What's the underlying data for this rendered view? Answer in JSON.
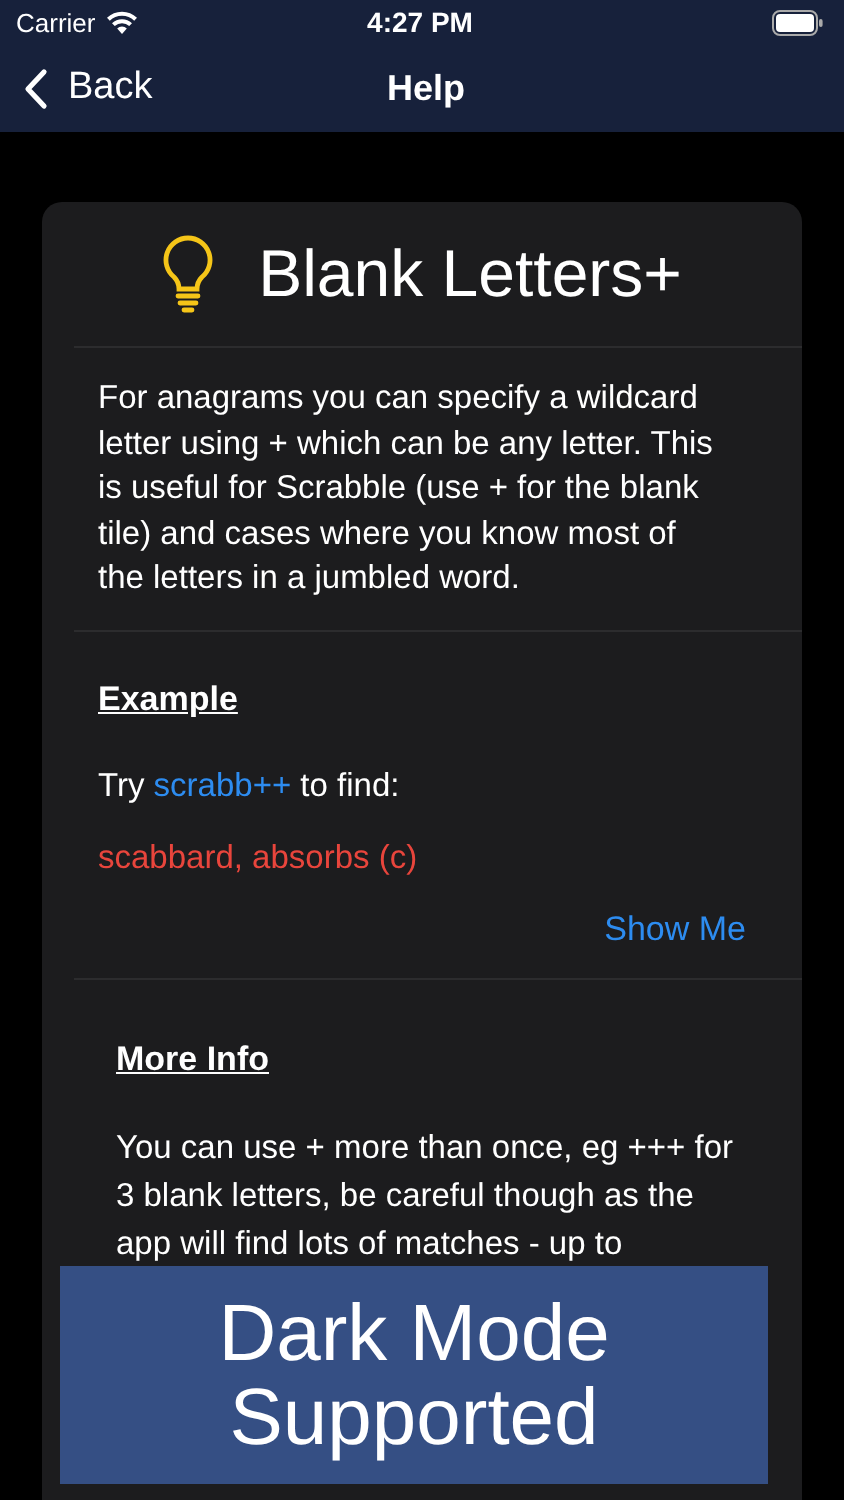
{
  "status_bar": {
    "carrier": "Carrier",
    "time": "4:27 PM"
  },
  "nav": {
    "back": "Back",
    "title": "Help"
  },
  "card": {
    "title": "Blank Letters+",
    "intro": "For anagrams you can specify a wildcard letter using + which can be any letter. This is useful for Scrabble (use + for the blank tile) and cases where you know most of the letters in a jumbled word.",
    "example_heading": "Example",
    "try_before": "Try ",
    "try_link": "scrabb++",
    "try_after": " to find:",
    "result": "scabbard, absorbs (c)",
    "show_me": "Show Me",
    "more_heading": "More Info",
    "more_text": "You can use + more than once, eg +++ for 3 blank letters, be careful though as the app will find lots of matches - up to"
  },
  "banner": "Dark Mode Supported"
}
